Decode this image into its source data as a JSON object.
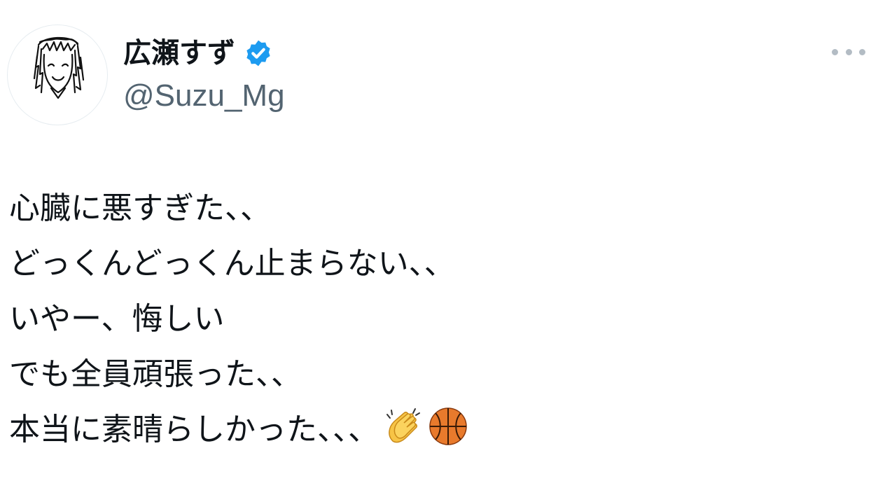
{
  "author": {
    "display_name": "広瀬すず",
    "handle": "@Suzu_Mg",
    "verified": true,
    "avatar_icon": "sketch-portrait-avatar",
    "verified_icon": "verified-badge-icon"
  },
  "actions": {
    "more_icon": "more-options-icon"
  },
  "tweet": {
    "lines": [
      "心臓に悪すぎた、、",
      "どっくんどっくん止まらない、、",
      "いやー、悔しい",
      "でも全員頑張った、、",
      "本当に素晴らしかった、、、"
    ],
    "emojis": [
      "clapping-hands-emoji",
      "basketball-emoji"
    ]
  },
  "colors": {
    "text": "#0f1419",
    "handle": "#536471",
    "verified": "#1d9bf0",
    "more_dots": "#b3bcc4",
    "background": "#ffffff"
  }
}
